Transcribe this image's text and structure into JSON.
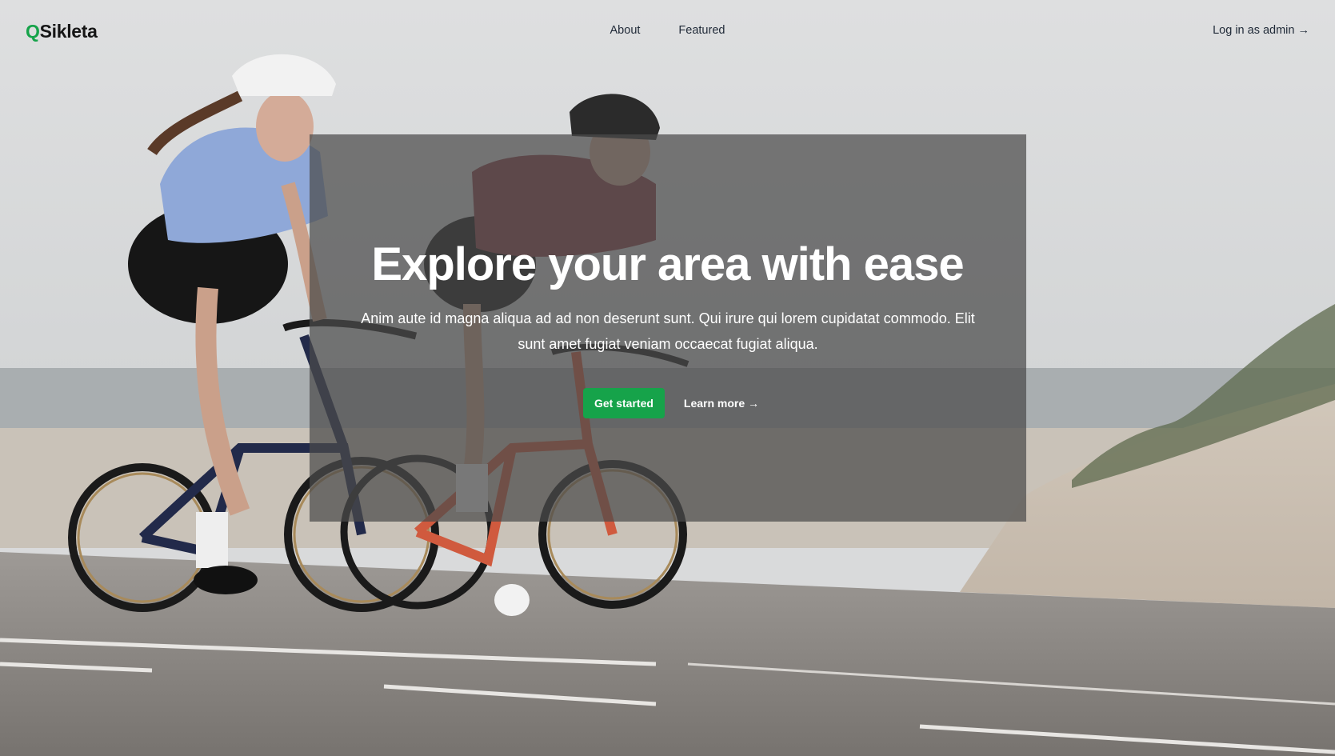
{
  "header": {
    "logo_mark": "Q",
    "logo_text": "Sikleta",
    "nav": [
      {
        "label": "About"
      },
      {
        "label": "Featured"
      }
    ],
    "login_label": "Log in as admin →"
  },
  "hero": {
    "title": "Explore your area with ease",
    "description": "Anim aute id magna aliqua ad ad non deserunt sunt. Qui irure qui lorem cupidatat commodo. Elit sunt amet fugiat veniam occaecat fugiat aliqua.",
    "primary_button": "Get started",
    "secondary_link": "Learn more →"
  },
  "colors": {
    "brand": "#16a34a",
    "overlay": "#4b4b4b",
    "text_dark": "#1f2937"
  },
  "background_image": "two-cyclists-on-coastal-road"
}
